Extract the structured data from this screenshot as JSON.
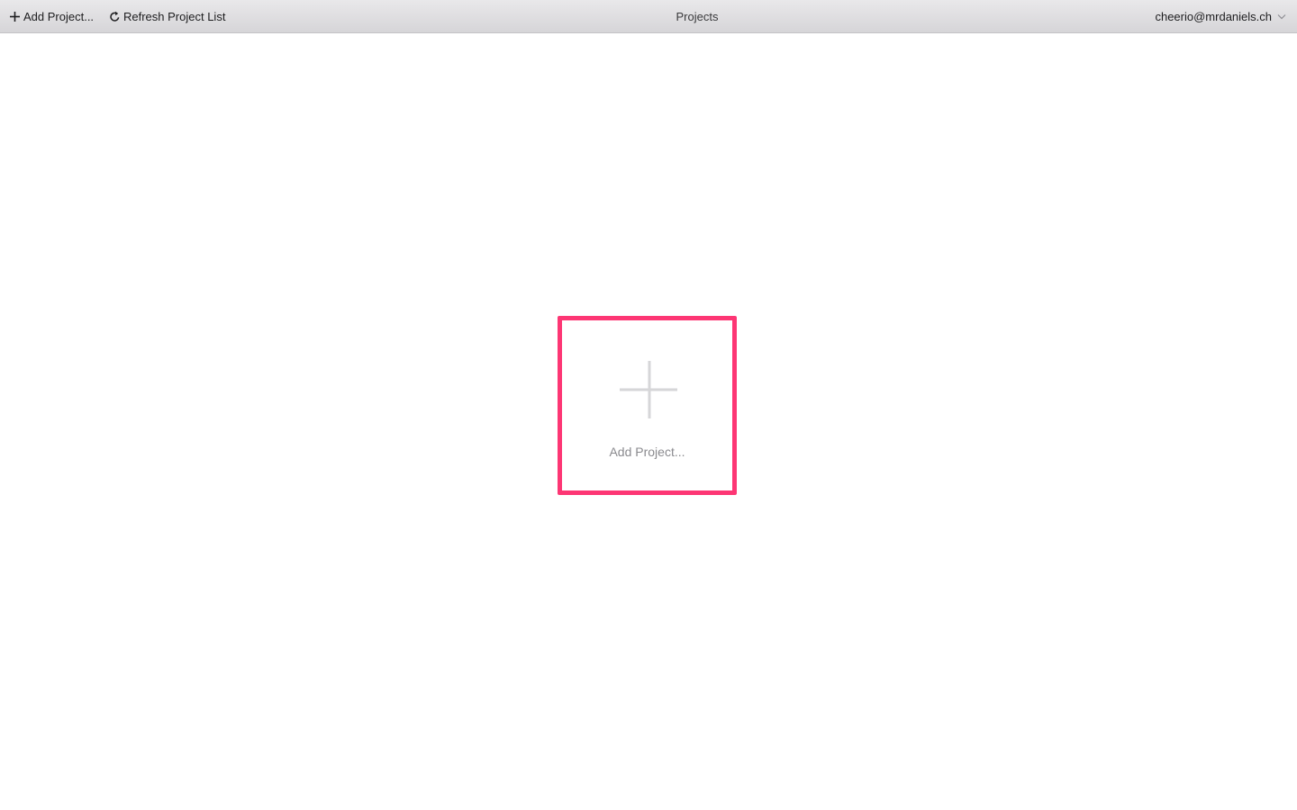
{
  "toolbar": {
    "add_project_label": "Add Project...",
    "refresh_label": "Refresh Project List",
    "title": "Projects",
    "account": "cheerio@mrdaniels.ch"
  },
  "main": {
    "add_card_label": "Add Project..."
  },
  "icons": {
    "add": "plus-icon",
    "refresh": "refresh-icon",
    "account_menu": "chevron-down-icon",
    "card": "plus-icon"
  },
  "colors": {
    "card_highlight": "#fd3674",
    "card_plus": "#d6d6d8",
    "card_text": "#8a8a8e"
  }
}
